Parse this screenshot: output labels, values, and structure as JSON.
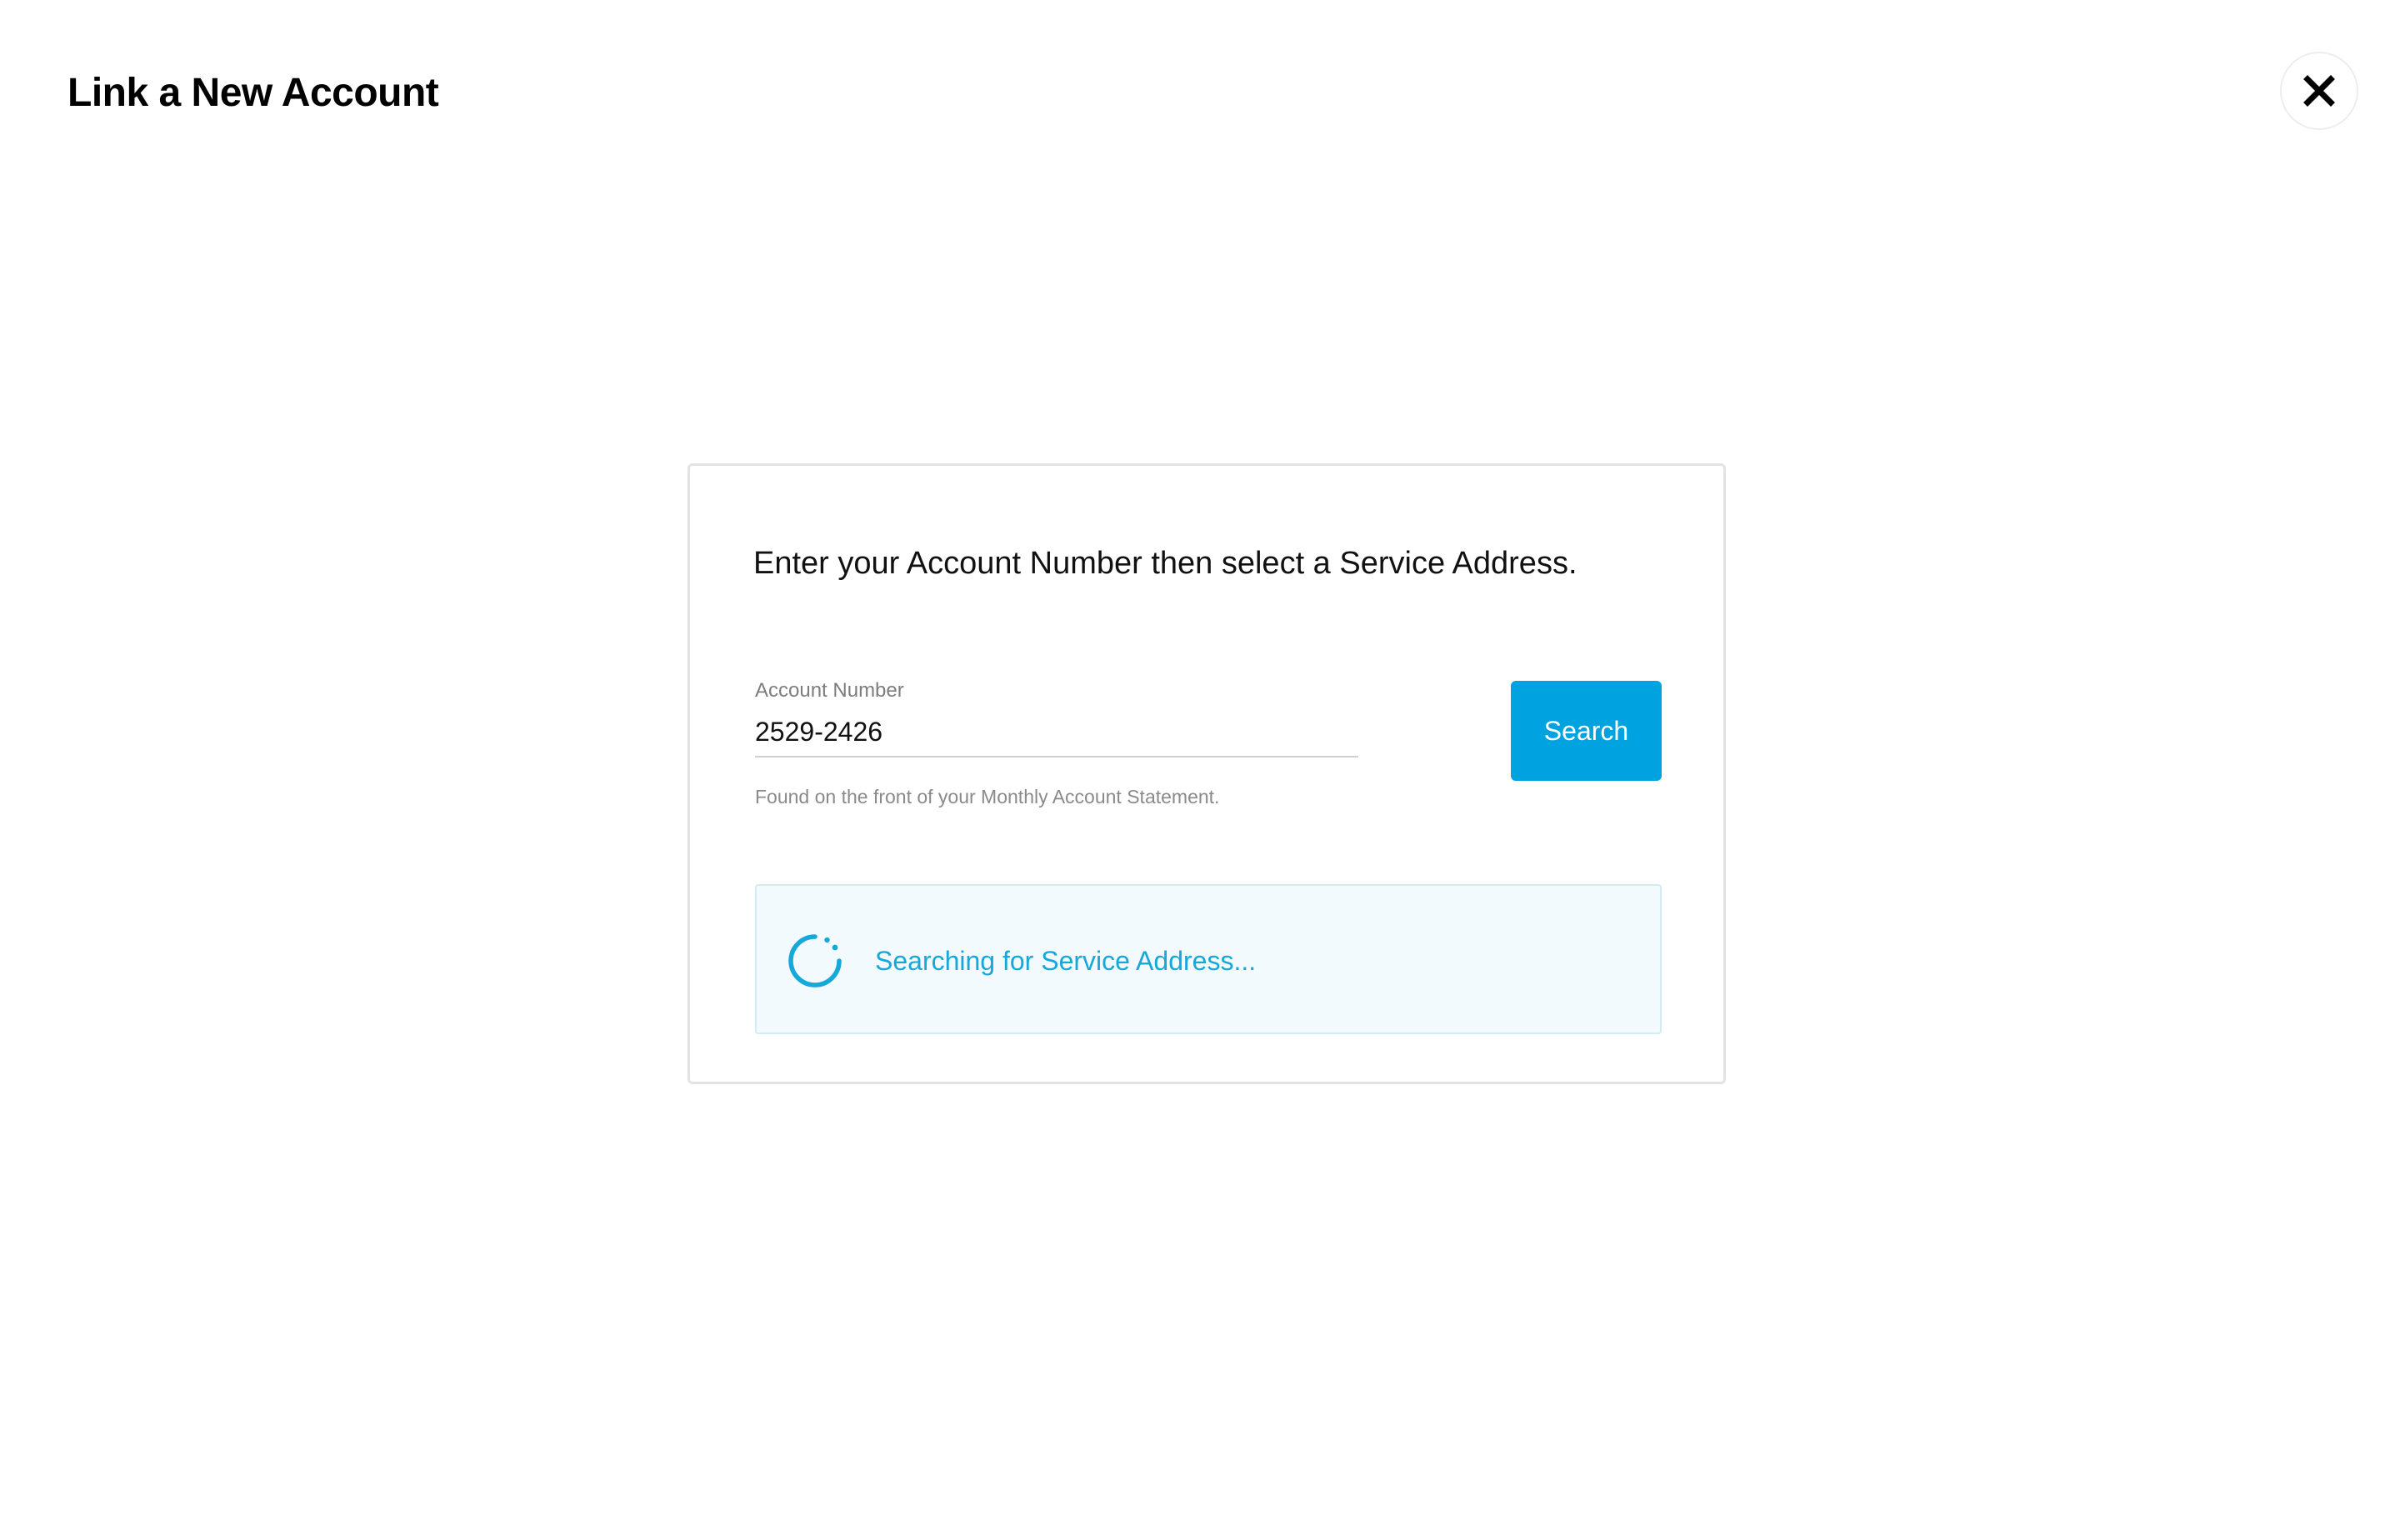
{
  "header": {
    "title": "Link a New Account",
    "close_icon": "close-icon"
  },
  "card": {
    "instruction": "Enter your Account Number then select a Service Address.",
    "account_field": {
      "label": "Account Number",
      "value": "2529-2426",
      "helper": "Found on the front of your Monthly Account Statement."
    },
    "search_label": "Search",
    "status": {
      "icon": "spinner-icon",
      "text": "Searching for Service Address..."
    }
  },
  "colors": {
    "accent": "#00a3e0",
    "status_text": "#15a8d8",
    "status_background": "#f2fafd"
  }
}
